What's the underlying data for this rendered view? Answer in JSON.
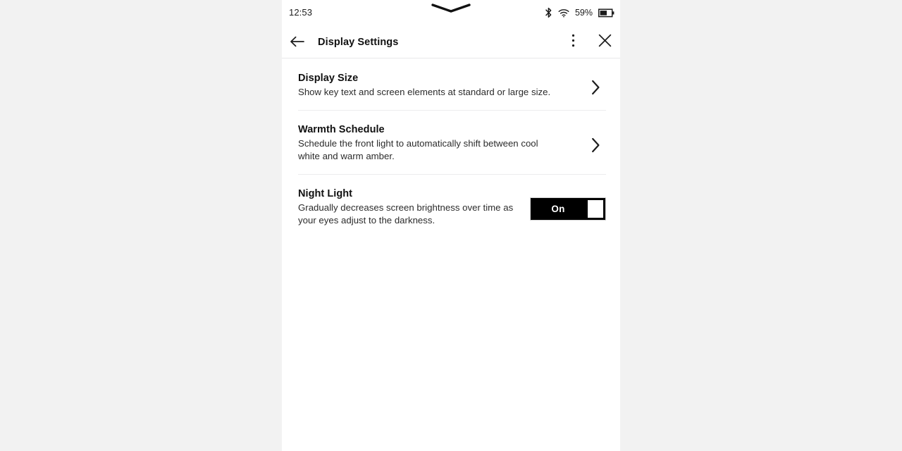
{
  "status_bar": {
    "clock": "12:53",
    "battery_percent": "59%",
    "icons": {
      "bluetooth": "bluetooth-icon",
      "wifi": "wifi-icon",
      "battery": "battery-icon",
      "notch": "notch-indicator-icon"
    }
  },
  "app_bar": {
    "title": "Display Settings",
    "back_icon": "back-arrow-icon",
    "overflow_icon": "more-vertical-icon",
    "close_icon": "close-icon"
  },
  "settings": [
    {
      "title": "Display Size",
      "description": "Show key text and screen elements at standard or large size.",
      "control": "chevron",
      "chevron_icon": "chevron-right-icon"
    },
    {
      "title": "Warmth Schedule",
      "description": "Schedule the front light to automatically shift between cool white and warm amber.",
      "control": "chevron",
      "chevron_icon": "chevron-right-icon"
    },
    {
      "title": "Night Light",
      "description": "Gradually decreases screen brightness over time as your eyes adjust to the darkness.",
      "control": "toggle",
      "toggle_state": "On"
    }
  ],
  "colors": {
    "page_background": "#f2f2f2",
    "screen_background": "#ffffff",
    "text_primary": "#111111",
    "text_secondary": "#2b2b2b",
    "divider": "#ececee",
    "toggle_on_track": "#000000",
    "toggle_knob": "#ffffff"
  }
}
